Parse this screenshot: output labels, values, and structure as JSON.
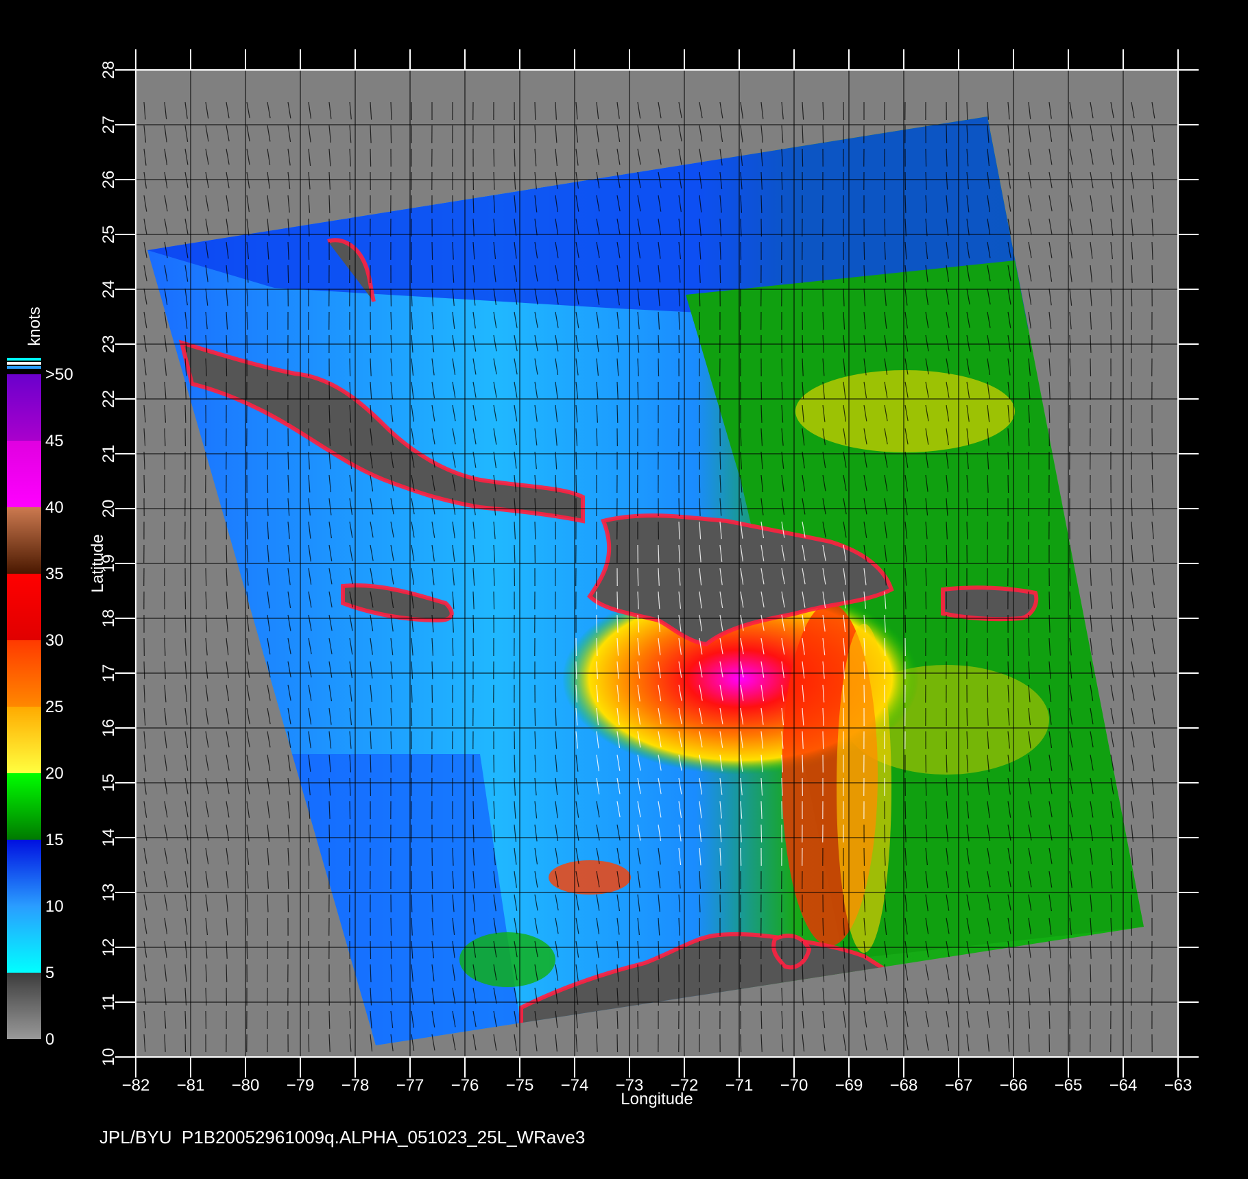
{
  "map": {
    "xlabel": "Longitude",
    "ylabel": "Latitude",
    "xlim": [
      -82,
      -63
    ],
    "ylim": [
      10,
      28
    ],
    "x_ticks": [
      "−82",
      "−81",
      "−80",
      "−79",
      "−78",
      "−77",
      "−76",
      "−75",
      "−74",
      "−73",
      "−72",
      "−71",
      "−70",
      "−69",
      "−68",
      "−67",
      "−66",
      "−65",
      "−64",
      "−63"
    ],
    "y_ticks": [
      "10",
      "11",
      "12",
      "13",
      "14",
      "15",
      "16",
      "17",
      "18",
      "19",
      "20",
      "21",
      "22",
      "23",
      "24",
      "25",
      "26",
      "27",
      "28"
    ],
    "grid": true,
    "background_color": "#808080",
    "land_color": "#555555"
  },
  "colorbar": {
    "title": "knots",
    "labels": [
      "0",
      "5",
      "10",
      "15",
      "20",
      "25",
      "30",
      "35",
      "40",
      "45",
      ">50"
    ],
    "bands": [
      {
        "from": 0,
        "to": 5,
        "colors": [
          "#999999",
          "#3c3c3c"
        ]
      },
      {
        "from": 5,
        "to": 10,
        "colors": [
          "#00ffff",
          "#2a9dff"
        ]
      },
      {
        "from": 10,
        "to": 15,
        "colors": [
          "#2a9dff",
          "#0010e0"
        ]
      },
      {
        "from": 15,
        "to": 20,
        "colors": [
          "#007a00",
          "#00ff00"
        ]
      },
      {
        "from": 20,
        "to": 25,
        "colors": [
          "#ffff40",
          "#ffaa00"
        ]
      },
      {
        "from": 25,
        "to": 30,
        "colors": [
          "#ff8800",
          "#ff3a00"
        ]
      },
      {
        "from": 30,
        "to": 35,
        "colors": [
          "#e00000",
          "#ff0000"
        ]
      },
      {
        "from": 35,
        "to": 40,
        "colors": [
          "#4a1800",
          "#cc7a50"
        ]
      },
      {
        "from": 40,
        "to": 45,
        "colors": [
          "#ff00ff",
          "#e000e0"
        ]
      },
      {
        "from": 45,
        "to": 50,
        "colors": [
          "#aa00cc",
          "#6a00cc"
        ]
      }
    ]
  },
  "footer": {
    "text": "JPL/BYU  P1B20052961009q.ALPHA_051023_25L_WRave3"
  }
}
